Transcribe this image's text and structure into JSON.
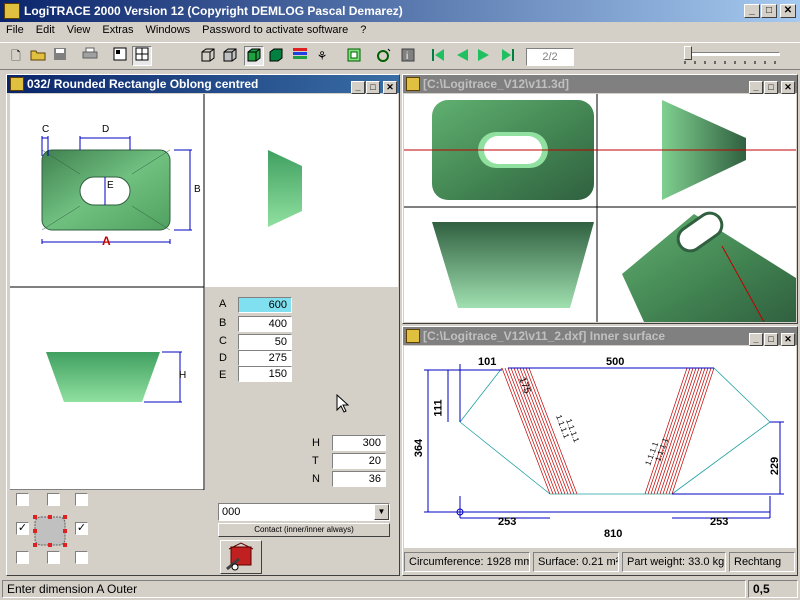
{
  "app": {
    "title": "LogiTRACE 2000  Version 12  (Copyright DEMLOG Pascal Demarez)"
  },
  "menu": [
    "File",
    "Edit",
    "View",
    "Extras",
    "Windows",
    "Password to activate software",
    "?"
  ],
  "toolbar": {
    "page_indicator": "2/2"
  },
  "window_main": {
    "title": "032/ Rounded Rectangle Oblong centred",
    "dim_labels": {
      "a": "A",
      "b": "B",
      "c": "C",
      "d": "D",
      "e": "E",
      "h": "H"
    },
    "fields": [
      {
        "label": "A",
        "value": "600"
      },
      {
        "label": "B",
        "value": "400"
      },
      {
        "label": "C",
        "value": "50"
      },
      {
        "label": "D",
        "value": "275"
      },
      {
        "label": "E",
        "value": "150"
      }
    ],
    "fields2": [
      {
        "label": "H",
        "value": "300"
      },
      {
        "label": "T",
        "value": "20"
      },
      {
        "label": "N",
        "value": "36"
      }
    ],
    "combo_value": "000",
    "contact_label": "Contact (inner/inner always)"
  },
  "window_3d": {
    "title": "[C:\\Logitrace_V12\\v11.3d]"
  },
  "window_dxf": {
    "title": "[C:\\Logitrace_V12\\v11_2.dxf]  Inner surface",
    "dims": {
      "d101": "101",
      "d500": "500",
      "d111": "111",
      "d364": "364",
      "d229": "229",
      "d253a": "253",
      "d253b": "253",
      "d810": "810",
      "d175": "175"
    },
    "info": {
      "circumference": "Circumference: 1928 mm",
      "surface": "Surface: 0.21 m²",
      "weight": "Part weight: 33.0 kg",
      "type": "Rechtang"
    }
  },
  "status": {
    "message": "Enter dimension A Outer",
    "value": "0,5"
  }
}
